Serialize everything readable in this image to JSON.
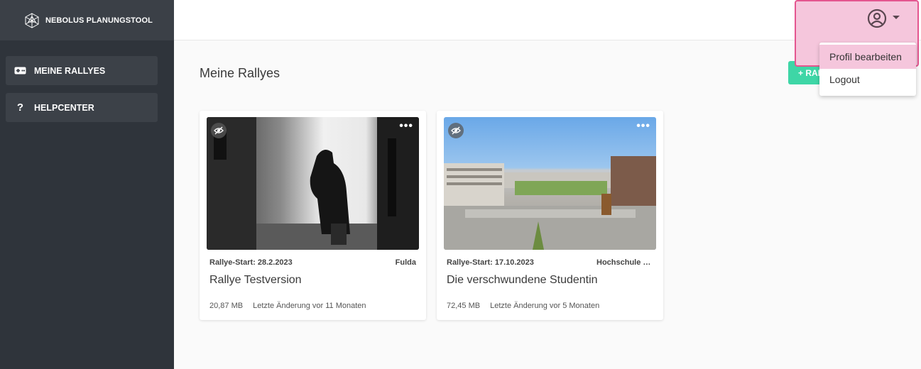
{
  "sidebar": {
    "brand": "NEBOLUS PLANUNGSTOOL",
    "items": [
      {
        "label": "MEINE RALLYES",
        "icon": "gamepad-icon"
      },
      {
        "label": "HELPCENTER",
        "icon": "question-icon"
      }
    ]
  },
  "main": {
    "title": "Meine Rallyes",
    "add_button": "+ RALLYE"
  },
  "cards": [
    {
      "start": "Rallye-Start: 28.2.2023",
      "location": "Fulda",
      "title": "Rallye Testversion",
      "size": "20,87 MB",
      "modified": "Letzte Änderung vor 11 Monaten"
    },
    {
      "start": "Rallye-Start: 17.10.2023",
      "location": "Hochschule Fulda",
      "title": "Die verschwundene Studentin",
      "size": "72,45 MB",
      "modified": "Letzte Änderung vor 5 Monaten"
    }
  ],
  "profile_menu": {
    "items": [
      "Profil bearbeiten",
      "Logout"
    ]
  },
  "colors": {
    "sidebar_bg": "#2f343b",
    "accent_green": "#3ed6a6",
    "highlight_pink": "#f5c6dc",
    "highlight_border": "#e4568f"
  }
}
